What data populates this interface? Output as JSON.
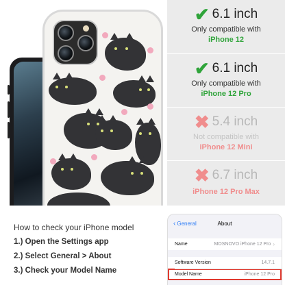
{
  "product": {
    "image_alt": "Black cats pattern phone case"
  },
  "compatibility": [
    {
      "status": "compatible",
      "mark": "✔",
      "size": "6.1 inch",
      "note": "Only compatible with",
      "model": "iPhone 12"
    },
    {
      "status": "compatible",
      "mark": "✔",
      "size": "6.1 inch",
      "note": "Only compatible with",
      "model": "iPhone 12 Pro"
    },
    {
      "status": "not-compatible",
      "mark": "✖",
      "size": "5.4 inch",
      "note": "Not compatible with",
      "model": "iPhone 12 Mini"
    },
    {
      "status": "not-compatible",
      "mark": "✖",
      "size": "6.7 inch",
      "note": "Not compatible with",
      "model": "iPhone 12 Pro Max"
    }
  ],
  "colors": {
    "compatible": "#2fa43a",
    "not_compatible": "#f08d8d",
    "panel_bg": "#ebebeb",
    "highlight": "#e03a2f",
    "ios_link": "#2c7cf6"
  },
  "instructions": {
    "title": "How to check your iPhone model",
    "steps": [
      "1.) Open the Settings app",
      "2.) Select General > About",
      "3.) Check your Model Name"
    ]
  },
  "settings": {
    "back_label": "General",
    "back_icon": "chevron-left-icon",
    "title": "About",
    "rows": [
      {
        "label": "Name",
        "value": "MOSNOVO iPhone 12 Pro"
      },
      {
        "label": "Software Version",
        "value": "14.7.1"
      },
      {
        "label": "Model Name",
        "value": "iPhone 12 Pro"
      }
    ]
  }
}
